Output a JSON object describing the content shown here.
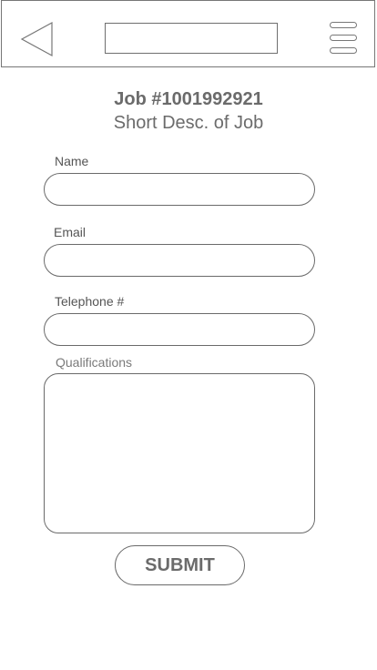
{
  "header": {
    "back_icon": "back-triangle-icon",
    "search_value": "",
    "search_placeholder": "",
    "menu_icon": "hamburger-menu-icon"
  },
  "job": {
    "title": "Job #1001992921",
    "description": "Short Desc. of Job"
  },
  "form": {
    "name": {
      "label": "Name",
      "value": "",
      "placeholder": ""
    },
    "email": {
      "label": "Email",
      "value": "",
      "placeholder": ""
    },
    "telephone": {
      "label": "Telephone #",
      "value": "",
      "placeholder": ""
    },
    "qualifications": {
      "label": "Qualifications",
      "value": "",
      "placeholder": ""
    },
    "submit_label": "SUBMIT"
  },
  "colors": {
    "border": "#6a6a6a",
    "text": "#555555",
    "heading": "#6b6b6b",
    "background": "#ffffff"
  }
}
